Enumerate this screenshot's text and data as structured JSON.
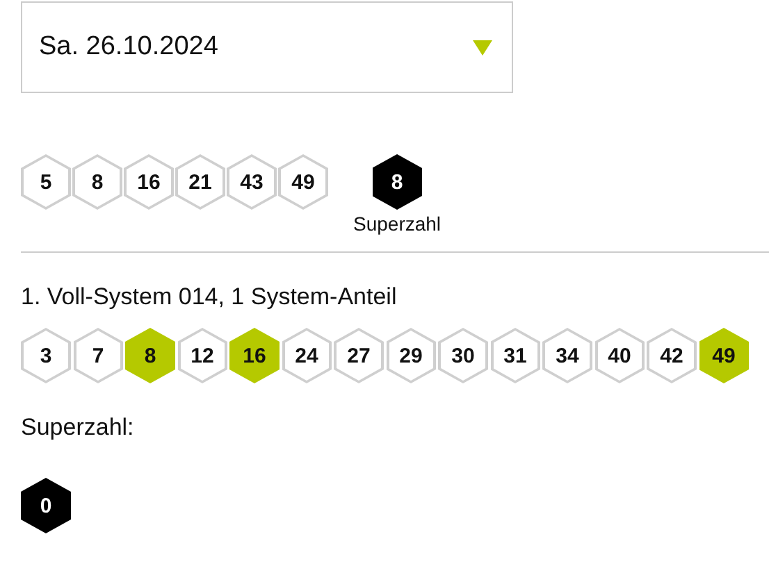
{
  "date_select": {
    "value": "Sa. 26.10.2024"
  },
  "draw": {
    "numbers": [
      "5",
      "8",
      "16",
      "21",
      "43",
      "49"
    ],
    "superzahl": "8",
    "superzahl_label": "Superzahl"
  },
  "ticket": {
    "title": "1. Voll-System 014, 1 System-Anteil",
    "numbers": [
      {
        "value": "3",
        "matched": false
      },
      {
        "value": "7",
        "matched": false
      },
      {
        "value": "8",
        "matched": true
      },
      {
        "value": "12",
        "matched": false
      },
      {
        "value": "16",
        "matched": true
      },
      {
        "value": "24",
        "matched": false
      },
      {
        "value": "27",
        "matched": false
      },
      {
        "value": "29",
        "matched": false
      },
      {
        "value": "30",
        "matched": false
      },
      {
        "value": "31",
        "matched": false
      },
      {
        "value": "34",
        "matched": false
      },
      {
        "value": "40",
        "matched": false
      },
      {
        "value": "42",
        "matched": false
      },
      {
        "value": "49",
        "matched": true
      }
    ],
    "superzahl_label": "Superzahl:",
    "superzahl": "0"
  }
}
